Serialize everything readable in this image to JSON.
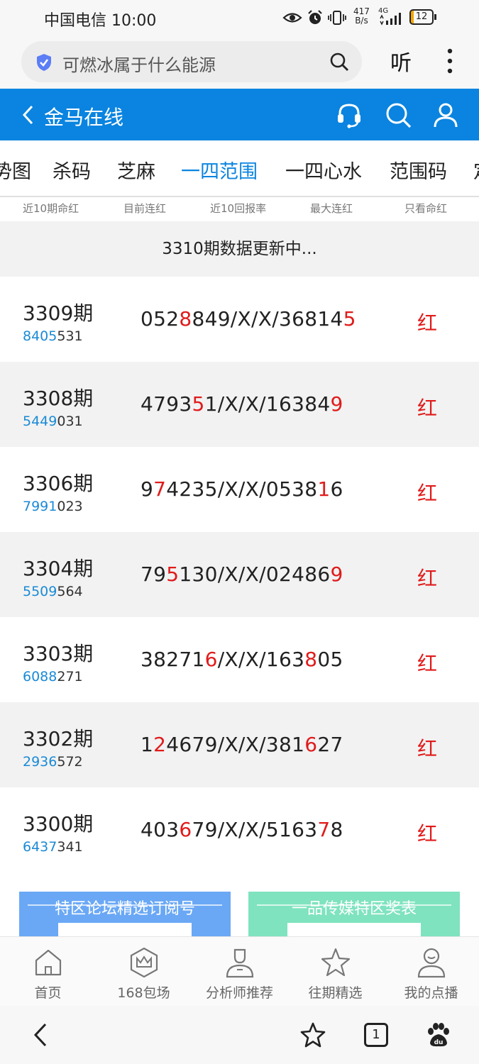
{
  "status_bar": {
    "carrier_time": "中国电信 10:00",
    "net_speed_value": "417",
    "net_speed_unit": "B/s",
    "network": "4G",
    "battery": "12",
    "battery_level": 0.12,
    "battery_color": "#f2a600"
  },
  "browser": {
    "search_text": "可燃冰属于什么能源",
    "listen_label": "听",
    "tab_count": "1"
  },
  "header": {
    "title": "金马在线",
    "bg_color": "#0a84e0",
    "icons": [
      "back-arrow-icon",
      "headset-icon",
      "search-icon",
      "user-icon"
    ]
  },
  "tabs": [
    {
      "label": "势图",
      "active": false
    },
    {
      "label": "杀码",
      "active": false
    },
    {
      "label": "芝麻",
      "active": false
    },
    {
      "label": "一四范围",
      "active": true
    },
    {
      "label": "一四心水",
      "active": false
    },
    {
      "label": "范围码",
      "active": false
    },
    {
      "label": "定",
      "active": false
    }
  ],
  "sub_header": [
    "近10期命红",
    "目前连红",
    "近10回报率",
    "最大连红",
    "只看命红"
  ],
  "updating_text": "3310期数据更新中...",
  "rows": [
    {
      "period": "3309期",
      "code_blue": "8405",
      "code_rest": "531",
      "nums": [
        [
          "052",
          ""
        ],
        [
          "8",
          "red"
        ],
        [
          "849/X/X/36814",
          ""
        ],
        [
          "5",
          "red"
        ]
      ],
      "result": "红"
    },
    {
      "period": "3308期",
      "code_blue": "5449",
      "code_rest": "031",
      "nums": [
        [
          "4793",
          ""
        ],
        [
          "5",
          "red"
        ],
        [
          "1/X/X/16384",
          ""
        ],
        [
          "9",
          "red"
        ]
      ],
      "result": "红"
    },
    {
      "period": "3306期",
      "code_blue": "7991",
      "code_rest": "023",
      "nums": [
        [
          "9",
          ""
        ],
        [
          "7",
          "red"
        ],
        [
          "4235/X/X/0538",
          ""
        ],
        [
          "1",
          "red"
        ],
        [
          "6",
          ""
        ]
      ],
      "result": "红"
    },
    {
      "period": "3304期",
      "code_blue": "5509",
      "code_rest": "564",
      "nums": [
        [
          "79",
          ""
        ],
        [
          "5",
          "red"
        ],
        [
          "130/X/X/02486",
          ""
        ],
        [
          "9",
          "red"
        ]
      ],
      "result": "红"
    },
    {
      "period": "3303期",
      "code_blue": "6088",
      "code_rest": "271",
      "nums": [
        [
          "38271",
          ""
        ],
        [
          "6",
          "red"
        ],
        [
          "/X/X/163",
          ""
        ],
        [
          "8",
          "red"
        ],
        [
          "05",
          ""
        ]
      ],
      "result": "红"
    },
    {
      "period": "3302期",
      "code_blue": "2936",
      "code_rest": "572",
      "nums": [
        [
          "1",
          ""
        ],
        [
          "2",
          "red"
        ],
        [
          "4679/X/X/381",
          ""
        ],
        [
          "6",
          "red"
        ],
        [
          "27",
          ""
        ]
      ],
      "result": "红"
    },
    {
      "period": "3300期",
      "code_blue": "6437",
      "code_rest": "341",
      "nums": [
        [
          "403",
          ""
        ],
        [
          "6",
          "red"
        ],
        [
          "79/X/X/5163",
          ""
        ],
        [
          "7",
          "red"
        ],
        [
          "8",
          ""
        ]
      ],
      "result": "红"
    }
  ],
  "promos": [
    {
      "title": "特区论坛精选订阅号",
      "color": "#6aa8f5"
    },
    {
      "title": "一品传媒特区奖表",
      "color": "#7fe3bf"
    }
  ],
  "app_nav": [
    {
      "label": "首页",
      "icon": "home-icon"
    },
    {
      "label": "168包场",
      "icon": "crown-icon"
    },
    {
      "label": "分析师推荐",
      "icon": "analyst-icon"
    },
    {
      "label": "往期精选",
      "icon": "star-icon"
    },
    {
      "label": "我的点播",
      "icon": "profile-icon"
    }
  ],
  "colors": {
    "accent": "#0a84e0",
    "red": "#e01b1b",
    "blue_code": "#1a8ad6"
  }
}
